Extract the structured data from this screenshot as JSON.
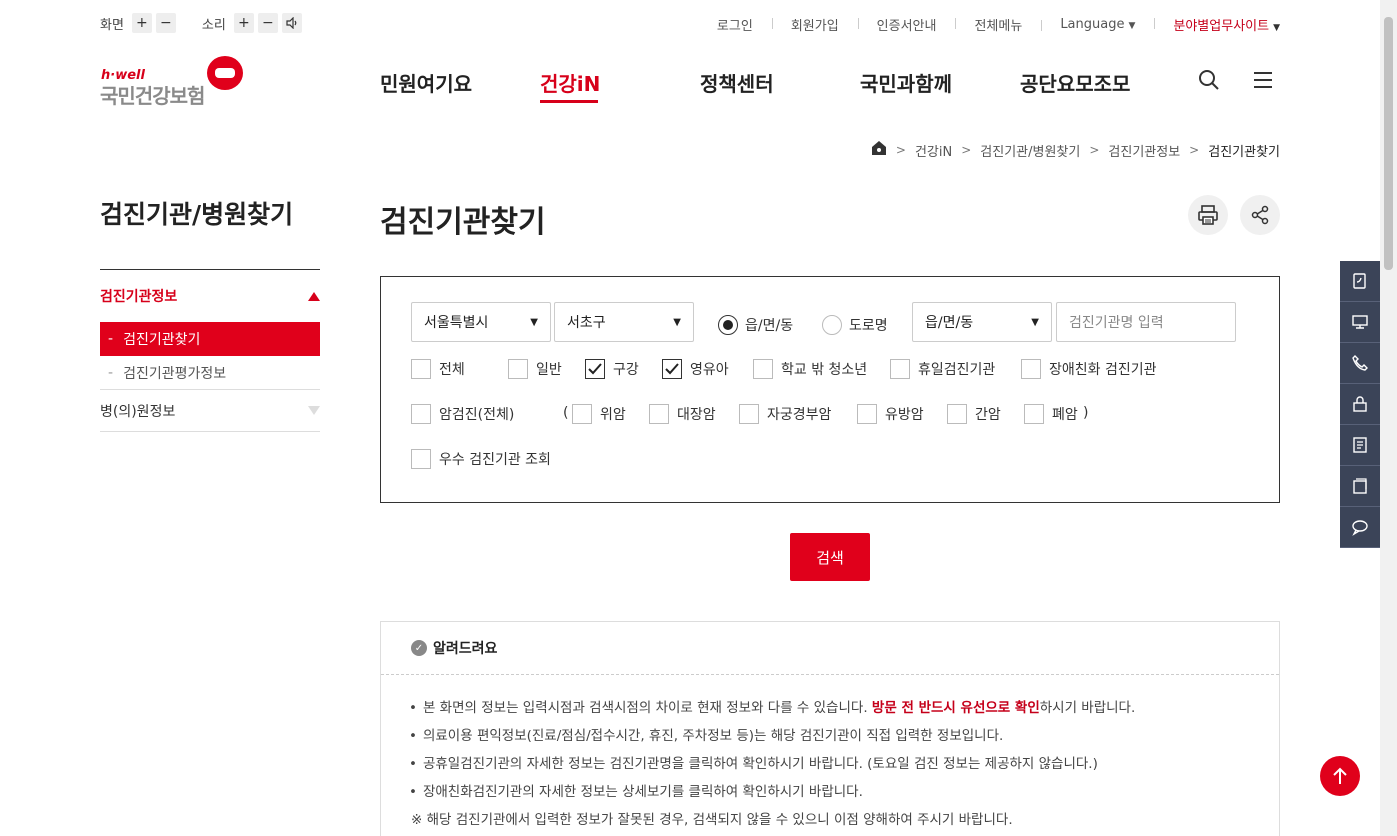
{
  "util": {
    "screen_label": "화면",
    "sound_label": "소리",
    "plus": "+",
    "minus": "−"
  },
  "topnav": {
    "login": "로그인",
    "join": "회원가입",
    "cert": "인증서안내",
    "allmenu": "전체메뉴",
    "language": "Language",
    "field_site": "분야별업무사이트"
  },
  "logo": {
    "hwell": "h·well",
    "name": "국민건강보험"
  },
  "gnb": [
    "민원여기요",
    "건강iN",
    "정책센터",
    "국민과함께",
    "공단요모조모"
  ],
  "breadcrumb": [
    "건강iN",
    "검진기관/병원찾기",
    "검진기관정보",
    "검진기관찾기"
  ],
  "side": {
    "title": "검진기관/병원찾기",
    "group1": "검진기관정보",
    "active": "검진기관찾기",
    "sub": "검진기관평가정보",
    "group2": "병(의)원정보"
  },
  "main": {
    "title": "검진기관찾기"
  },
  "search": {
    "sido": "서울특별시",
    "sigungu": "서초구",
    "radio_emd": "읍/면/동",
    "radio_road": "도로명",
    "emd_select": "읍/면/동",
    "name_placeholder": "검진기관명 입력",
    "types": [
      "전체",
      "일반",
      "구강",
      "영유아",
      "학교 밖 청소년",
      "휴일검진기관",
      "장애친화 검진기관"
    ],
    "cancer_all": "암검진(전체)",
    "paren_open": "(",
    "paren_close": ")",
    "cancers": [
      "위암",
      "대장암",
      "자궁경부암",
      "유방암",
      "간암",
      "폐암"
    ],
    "excellent": "우수 검진기관 조회",
    "button": "검색"
  },
  "notice": {
    "title": "알려드려요",
    "items": [
      {
        "pre": "본 화면의 정보는 입력시점과 검색시점의 차이로 현재 정보와 다를 수 있습니다. ",
        "red": "방문 전 반드시 유선으로 확인",
        "post": "하시기 바랍니다."
      },
      {
        "pre": "의료이용 편익정보(진료/점심/접수시간, 휴진, 주차정보 등)는 해당 검진기관이 직접 입력한 정보입니다.",
        "red": "",
        "post": ""
      },
      {
        "pre": "공휴일검진기관의 자세한 정보는 검진기관명을 클릭하여 확인하시기 바랍니다. (토요일 검진 정보는 제공하지 않습니다.)",
        "red": "",
        "post": ""
      },
      {
        "pre": "장애친화검진기관의 자세한 정보는 상세보기를 클릭하여 확인하시기 바랍니다.",
        "red": "",
        "post": ""
      }
    ],
    "warn": "※ 해당 검진기관에서 입력한 정보가 잘못된 경우, 검색되지 않을 수 있으니 이점 양해하여 주시기 바랍니다."
  },
  "colors": {
    "brand_red": "#e0001b",
    "quick_bg": "#3b4458"
  }
}
